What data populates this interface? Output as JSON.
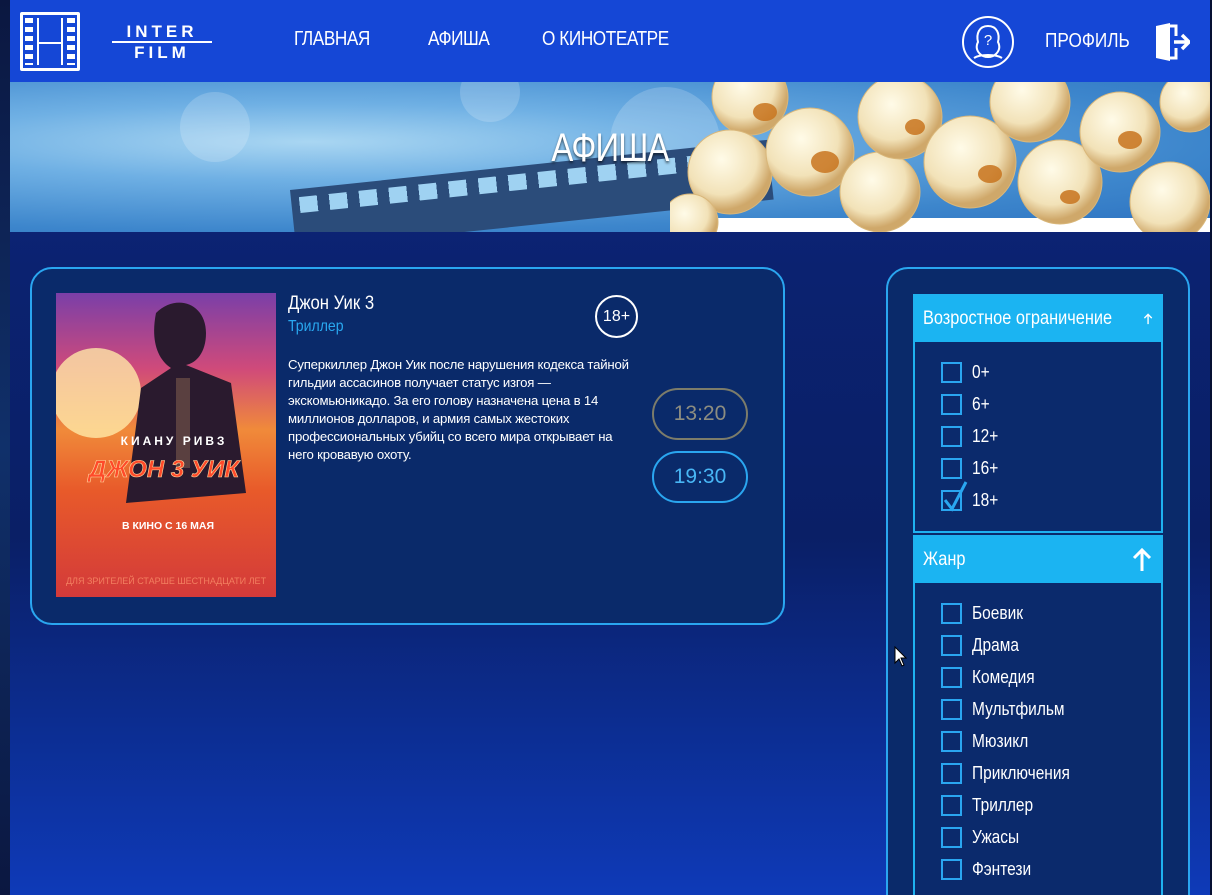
{
  "header": {
    "brand_line1": "INTER",
    "brand_line2": "FILM",
    "nav": [
      "ГЛАВНАЯ",
      "АФИША",
      "О КИНОТЕАТРЕ"
    ],
    "profile": "ПРОФИЛЬ",
    "icons": {
      "logo": "film-strip-icon",
      "help": "help-question-icon",
      "exit": "logout-door-icon"
    }
  },
  "banner": {
    "title": "АФИША"
  },
  "movie": {
    "title": "Джон Уик 3",
    "genre": "Триллер",
    "age_rating": "18+",
    "description": "Суперкиллер Джон Уик после нарушения кодекса тайной гильдии ассасинов получает статус изгоя — экскомьюникадо. За его голову назначена цена в 14 миллионов долларов, и армия самых жестоких профессиональных убийц со всего мира открывает на него кровавую охоту.",
    "poster": {
      "actor": "КИАНУ РИВЗ",
      "title": "ДЖОН 3 УИК",
      "release": "В КИНО С 16 МАЯ",
      "age_note": "ДЛЯ ЗРИТЕЛЕЙ СТАРШЕ ШЕСТНАДЦАТИ ЛЕТ"
    },
    "showtimes": [
      {
        "time": "13:20",
        "state": "past"
      },
      {
        "time": "19:30",
        "state": "available"
      }
    ]
  },
  "filters": {
    "age": {
      "title": "Возростное ограничение",
      "options": [
        {
          "label": "0+",
          "checked": false
        },
        {
          "label": "6+",
          "checked": false
        },
        {
          "label": "12+",
          "checked": false
        },
        {
          "label": "16+",
          "checked": false
        },
        {
          "label": "18+",
          "checked": true
        }
      ]
    },
    "genre": {
      "title": "Жанр",
      "options": [
        {
          "label": "Боевик",
          "checked": false
        },
        {
          "label": "Драма",
          "checked": false
        },
        {
          "label": "Комедия",
          "checked": false
        },
        {
          "label": "Мультфильм",
          "checked": false
        },
        {
          "label": "Мюзикл",
          "checked": false
        },
        {
          "label": "Приключения",
          "checked": false
        },
        {
          "label": "Триллер",
          "checked": false
        },
        {
          "label": "Ужасы",
          "checked": false
        },
        {
          "label": "Фэнтези",
          "checked": false
        }
      ]
    }
  },
  "colors": {
    "header": "#1547d6",
    "accent": "#2aa6f0",
    "filter_head": "#1bb4f2",
    "card_bg": "#0a2a6a",
    "past_time": "#8d8d80"
  }
}
